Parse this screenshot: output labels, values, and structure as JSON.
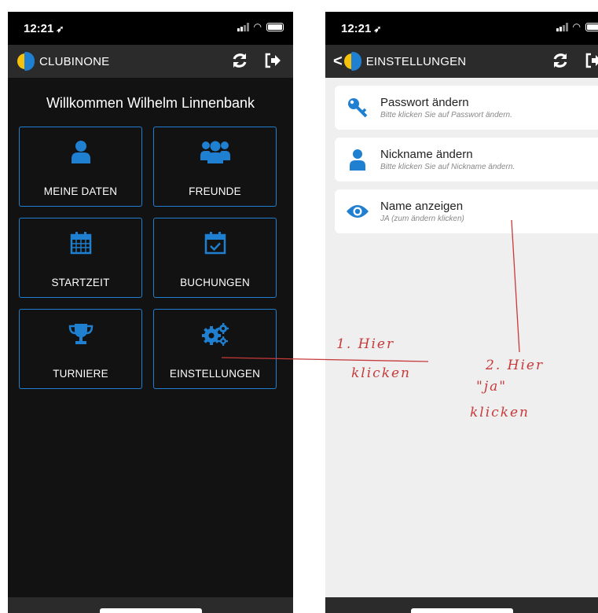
{
  "left_screen": {
    "status": {
      "time": "12:21",
      "location_glyph": "➶"
    },
    "appbar": {
      "title": "CLUBINONE",
      "icons": [
        "refresh-icon",
        "logout-icon"
      ]
    },
    "welcome": "Willkommen Wilhelm Linnenbank",
    "tiles": [
      {
        "label": "MEINE DATEN",
        "icon": "person-icon"
      },
      {
        "label": "FREUNDE",
        "icon": "friends-icon"
      },
      {
        "label": "STARTZEIT",
        "icon": "calendar-icon"
      },
      {
        "label": "BUCHUNGEN",
        "icon": "calendar-check-icon"
      },
      {
        "label": "TURNIERE",
        "icon": "trophy-icon"
      },
      {
        "label": "EINSTELLUNGEN",
        "icon": "gears-icon"
      }
    ]
  },
  "right_screen": {
    "status": {
      "time": "12:21",
      "location_glyph": "➶"
    },
    "appbar": {
      "back": "<",
      "title": "EINSTELLUNGEN",
      "icons": [
        "refresh-icon",
        "logout-icon"
      ]
    },
    "settings": [
      {
        "title": "Passwort ändern",
        "subtitle": "Bitte klicken Sie auf Passwort ändern.",
        "icon": "key-icon"
      },
      {
        "title": "Nickname ändern",
        "subtitle": "Bitte klicken Sie auf Nickname ändern.",
        "icon": "person-icon"
      },
      {
        "title": "Name anzeigen",
        "subtitle": "JA (zum ändern klicken)",
        "icon": "eye-icon"
      }
    ]
  },
  "annotations": {
    "step1_line1": "1. Hier",
    "step1_line2": "klicken",
    "step2_line1": "2. Hier",
    "step2_line2": "\"ja\"",
    "step2_line3": "klicken",
    "color": "#c73a3a"
  },
  "colors": {
    "accent": "#1f7fd0",
    "logo_yellow": "#f4c20d",
    "dark_bg": "#121212",
    "appbar_bg": "#2b2b2b"
  }
}
